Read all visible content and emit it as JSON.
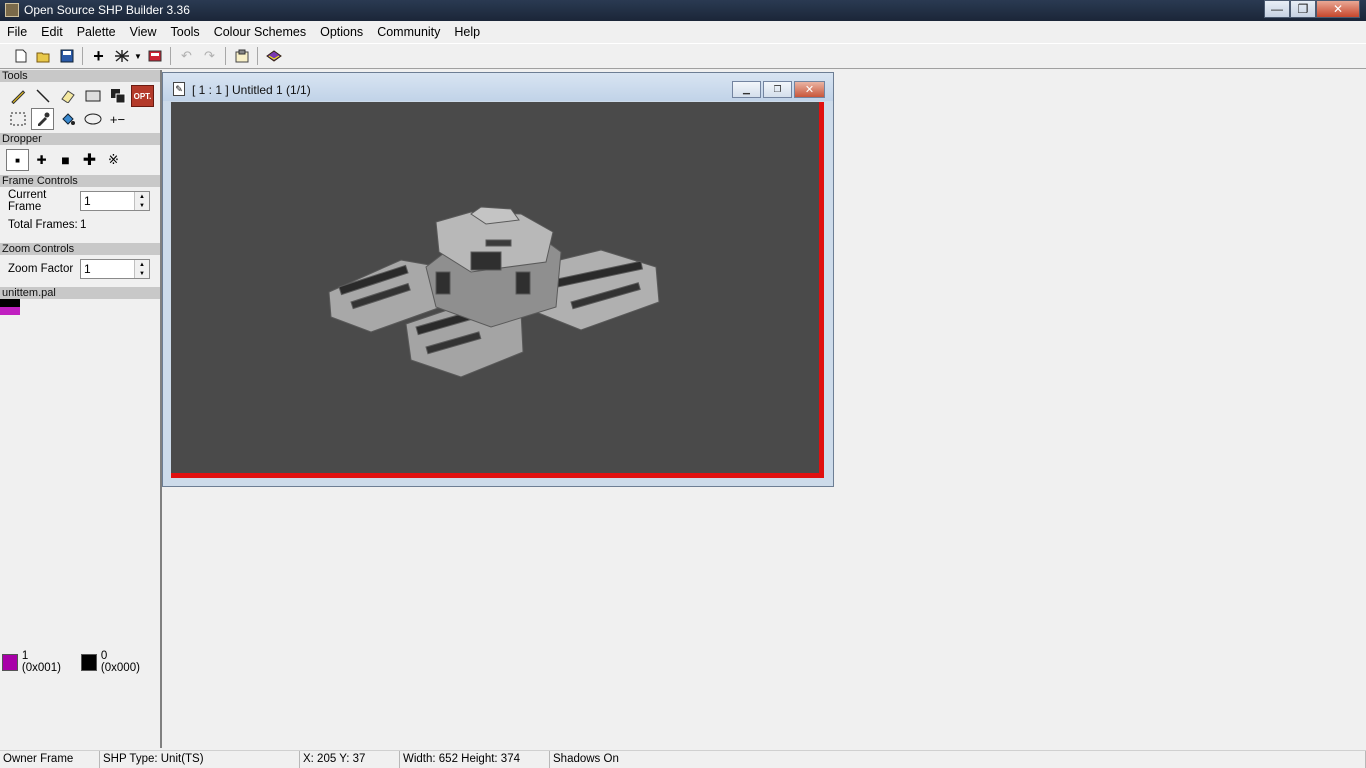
{
  "window": {
    "title": "Open Source SHP Builder 3.36",
    "minimize": "—",
    "maximize": "❐",
    "close": "✕"
  },
  "menu": [
    "File",
    "Edit",
    "Palette",
    "View",
    "Tools",
    "Colour Schemes",
    "Options",
    "Community",
    "Help"
  ],
  "toolbar": {
    "new_icon": "new-file-icon",
    "open_icon": "open-folder-icon",
    "save_icon": "save-disk-icon",
    "add_frame_icon": "plus-icon",
    "preview_icon": "preview-grid-icon",
    "dropdown_icon": "chevron-down-icon",
    "export_icon": "export-image-icon",
    "undo_icon": "undo-icon",
    "redo_icon": "redo-icon",
    "properties_icon": "properties-icon",
    "help_book_icon": "help-book-icon"
  },
  "left": {
    "tools_header": "Tools",
    "tools": [
      {
        "name": "pencil-tool",
        "glyph": "✎"
      },
      {
        "name": "line-tool",
        "glyph": "╲"
      },
      {
        "name": "eraser-tool",
        "glyph": "⌫"
      },
      {
        "name": "rectangle-tool",
        "glyph": "▭"
      },
      {
        "name": "colour-swap-tool",
        "glyph": "◧"
      },
      {
        "name": "opt-tool",
        "glyph": "OPT."
      },
      {
        "name": "selection-tool",
        "glyph": "⬚"
      },
      {
        "name": "dropper-tool",
        "glyph": "✒"
      },
      {
        "name": "flood-fill-tool",
        "glyph": "◈"
      },
      {
        "name": "ellipse-tool",
        "glyph": "◯"
      },
      {
        "name": "offset-tool",
        "glyph": "+−"
      }
    ],
    "dropper_header": "Dropper",
    "dropper_sizes": [
      {
        "name": "brush-size-1",
        "glyph": "▪"
      },
      {
        "name": "brush-size-2",
        "glyph": "✚"
      },
      {
        "name": "brush-size-3",
        "glyph": "■"
      },
      {
        "name": "brush-size-4",
        "glyph": "✚"
      },
      {
        "name": "brush-spray",
        "glyph": "※"
      }
    ],
    "frame_header": "Frame Controls",
    "current_frame_label": "Current Frame",
    "current_frame_value": "1",
    "total_frames_label": "Total Frames:",
    "total_frames_value": "1",
    "zoom_header": "Zoom Controls",
    "zoom_factor_label": "Zoom Factor",
    "zoom_factor_value": "1",
    "palette_header": "unittem.pal",
    "active_colour": {
      "label": "1 (0x001)",
      "color": "#a800a8"
    },
    "background_colour": {
      "label": "0 (0x000)",
      "color": "#000000"
    }
  },
  "child": {
    "title": "[ 1 : 1 ] Untitled 1 (1/1)",
    "border_color": "#e01010",
    "canvas_color": "#4a4a4a"
  },
  "status": {
    "mode": "Owner Frame",
    "shp_type": "SHP Type: Unit(TS)",
    "coords": "X: 205 Y: 37",
    "size": "Width: 652 Height: 374",
    "shadows": "Shadows On"
  }
}
